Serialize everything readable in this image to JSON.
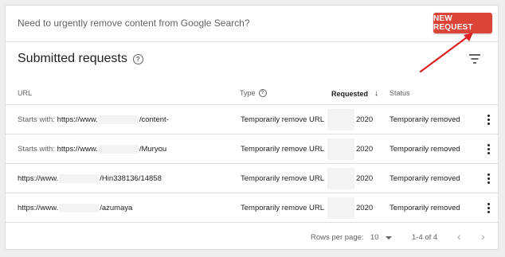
{
  "banner": {
    "question": "Need to urgently remove content from Google Search?",
    "new_request_label": "NEW REQUEST"
  },
  "section": {
    "title": "Submitted requests"
  },
  "table": {
    "headers": {
      "url": "URL",
      "type": "Type",
      "requested": "Requested",
      "status": "Status"
    },
    "rows": [
      {
        "url_prefix": "Starts with: ",
        "url_start": "https://www.",
        "url_end": "/content-",
        "type": "Temporarily remove URL",
        "requested": "2020",
        "status": "Temporarily removed"
      },
      {
        "url_prefix": "Starts with: ",
        "url_start": "https://www.",
        "url_end": "/Muryou",
        "type": "Temporarily remove URL",
        "requested": "2020",
        "status": "Temporarily removed"
      },
      {
        "url_prefix": "",
        "url_start": "https://www.",
        "url_end": "/Hin338136/14858",
        "type": "Temporarily remove URL",
        "requested": "2020",
        "status": "Temporarily removed"
      },
      {
        "url_prefix": "",
        "url_start": "https://www.",
        "url_end": "/azumaya",
        "type": "Temporarily remove URL",
        "requested": "2020",
        "status": "Temporarily removed"
      }
    ]
  },
  "pagination": {
    "rows_per_page_label": "Rows per page:",
    "rows_per_page_value": "10",
    "range": "1-4 of 4"
  },
  "colors": {
    "accent": "#db4437",
    "annotation_arrow": "#e02020"
  }
}
